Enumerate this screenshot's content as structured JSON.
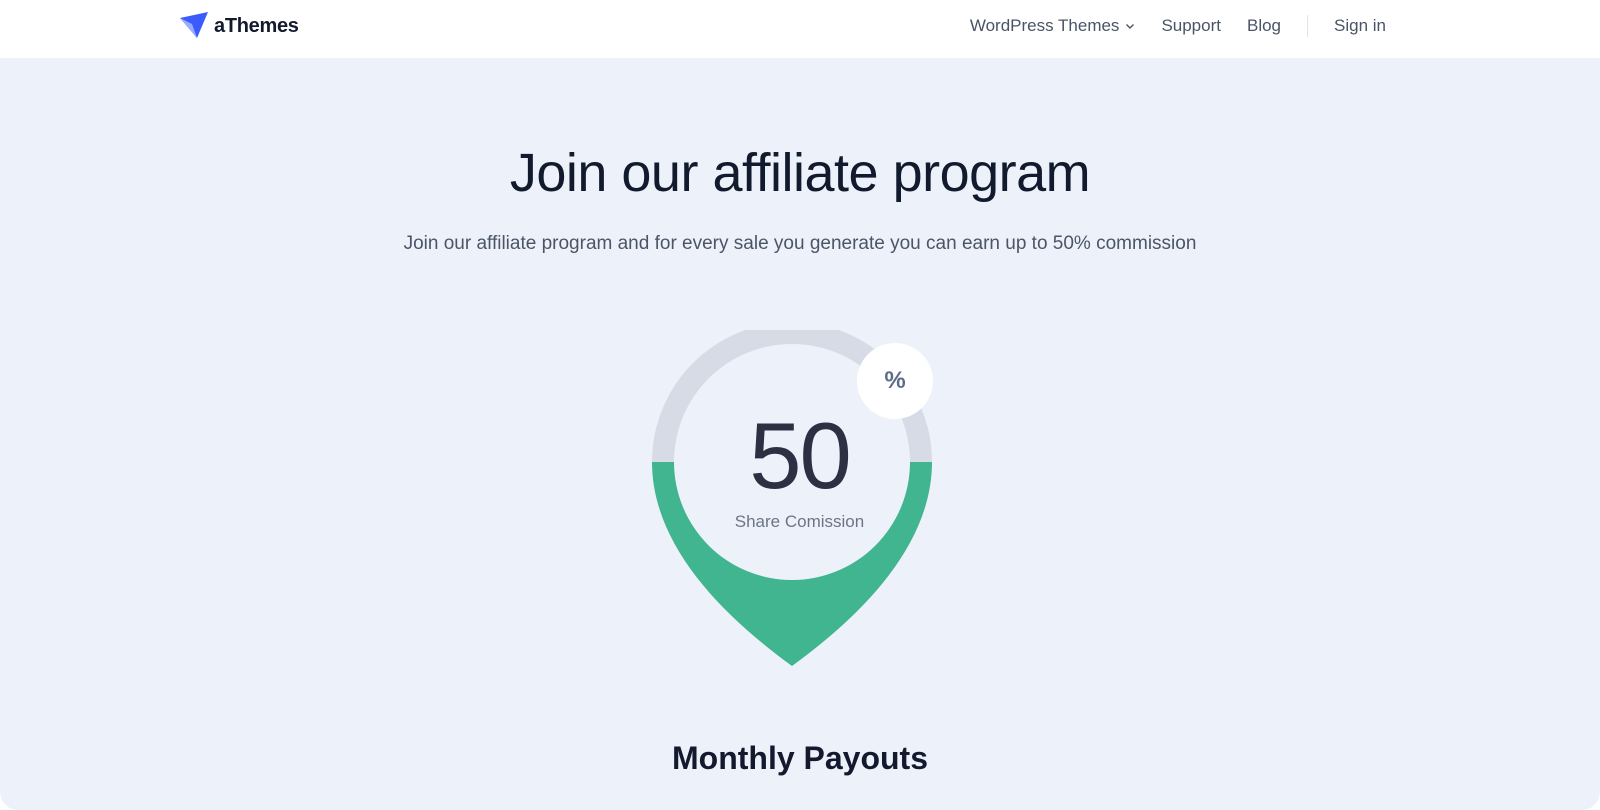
{
  "header": {
    "logo_text": "aThemes",
    "nav": {
      "themes_label": "WordPress Themes",
      "support_label": "Support",
      "blog_label": "Blog",
      "signin_label": "Sign in"
    }
  },
  "hero": {
    "title": "Join our affiliate program",
    "subtitle": "Join our affiliate program and for every sale you generate you can earn up to 50% commission",
    "gauge": {
      "value": "50",
      "unit_symbol": "%",
      "label": "Share Comission",
      "fill_fraction": 0.5
    },
    "section_title": "Monthly Payouts"
  },
  "colors": {
    "brand_blue": "#3b5bfd",
    "gauge_green": "#41b490",
    "gauge_track": "#d6dbe6",
    "hero_background": "#edf2fa"
  },
  "icons": {
    "logo": "paper-plane-icon",
    "themes_dropdown": "chevron-down-icon"
  }
}
